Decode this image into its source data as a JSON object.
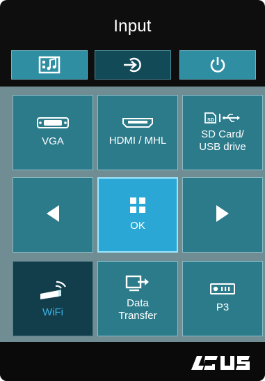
{
  "header": {
    "title": "Input"
  },
  "top_bar": [
    {
      "icon": "media-notes-icon"
    },
    {
      "icon": "input-source-icon"
    },
    {
      "icon": "power-icon"
    }
  ],
  "grid": {
    "vga": {
      "label": "VGA",
      "icon": "vga-port-icon"
    },
    "hdmi": {
      "label": "HDMI / MHL",
      "icon": "hdmi-port-icon"
    },
    "sd": {
      "label_line1": "SD Card/",
      "label_line2": "USB drive",
      "icon": "sd-usb-icon"
    },
    "left": {
      "icon": "arrow-left-icon"
    },
    "ok": {
      "label": "OK",
      "icon": "grid-icon"
    },
    "right": {
      "icon": "arrow-right-icon"
    },
    "wifi": {
      "label": "WiFi",
      "icon": "wifi-dongle-icon"
    },
    "data": {
      "label_line1": "Data",
      "label_line2": "Transfer",
      "icon": "data-transfer-icon"
    },
    "p3": {
      "label": "P3",
      "icon": "projector-icon"
    }
  },
  "footer": {
    "brand": "ASUS"
  },
  "colors": {
    "background": "#0e0e0e",
    "tile": "#2c7b8b",
    "tile_selected": "#2aa7d4",
    "tile_dark": "#123e4c",
    "accent_text": "#38b5e8"
  }
}
